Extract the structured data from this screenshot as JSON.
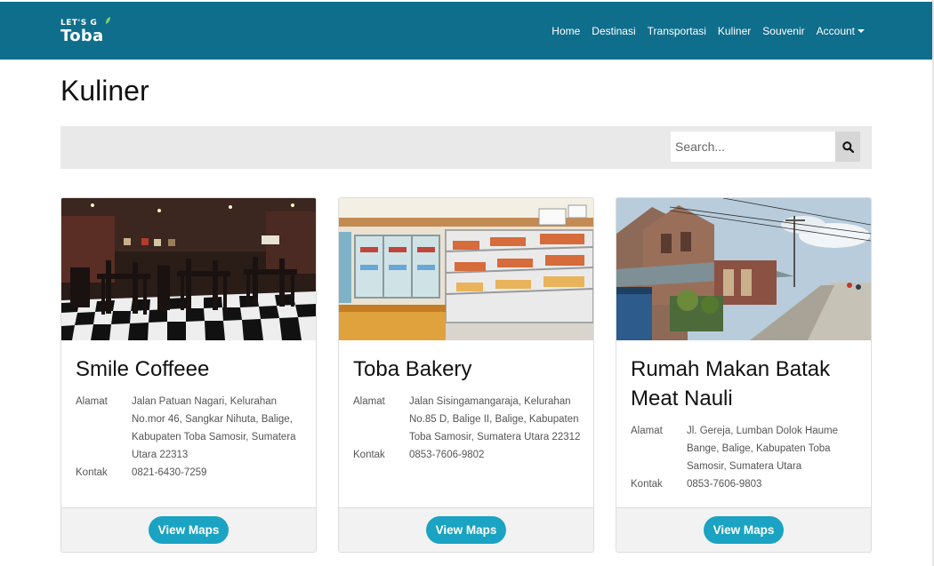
{
  "header": {
    "logo_top": "LET'S G",
    "logo_bottom": "Toba",
    "nav": [
      "Home",
      "Destinasi",
      "Transportasi",
      "Kuliner",
      "Souvenir"
    ],
    "account_label": "Account"
  },
  "main": {
    "title": "Kuliner",
    "search": {
      "placeholder": "Search..."
    }
  },
  "labels": {
    "alamat": "Alamat",
    "kontak": "Kontak",
    "view_maps": "View Maps"
  },
  "cards": [
    {
      "name": "Smile Coffeee",
      "alamat": "Jalan Patuan Nagari, Kelurahan No.mor 46, Sangkar Nihuta, Balige, Kabupaten Toba Samosir, Sumatera Utara 22313",
      "kontak": "0821-6430-7259"
    },
    {
      "name": "Toba Bakery",
      "alamat": "Jalan Sisingamangaraja, Kelurahan No.85 D, Balige II, Balige, Kabupaten Toba Samosir, Sumatera Utara 22312",
      "kontak": "0853-7606-9802"
    },
    {
      "name": "Rumah Makan Batak Meat Nauli",
      "alamat": "Jl. Gereja, Lumban Dolok Haume Bange, Balige, Kabupaten Toba Samosir, Sumatera Utara",
      "kontak": "0853-7606-9803"
    }
  ],
  "colors": {
    "navbar": "#0f6e8c",
    "button": "#1aa3c2",
    "search_bar": "#e9e9e9"
  }
}
